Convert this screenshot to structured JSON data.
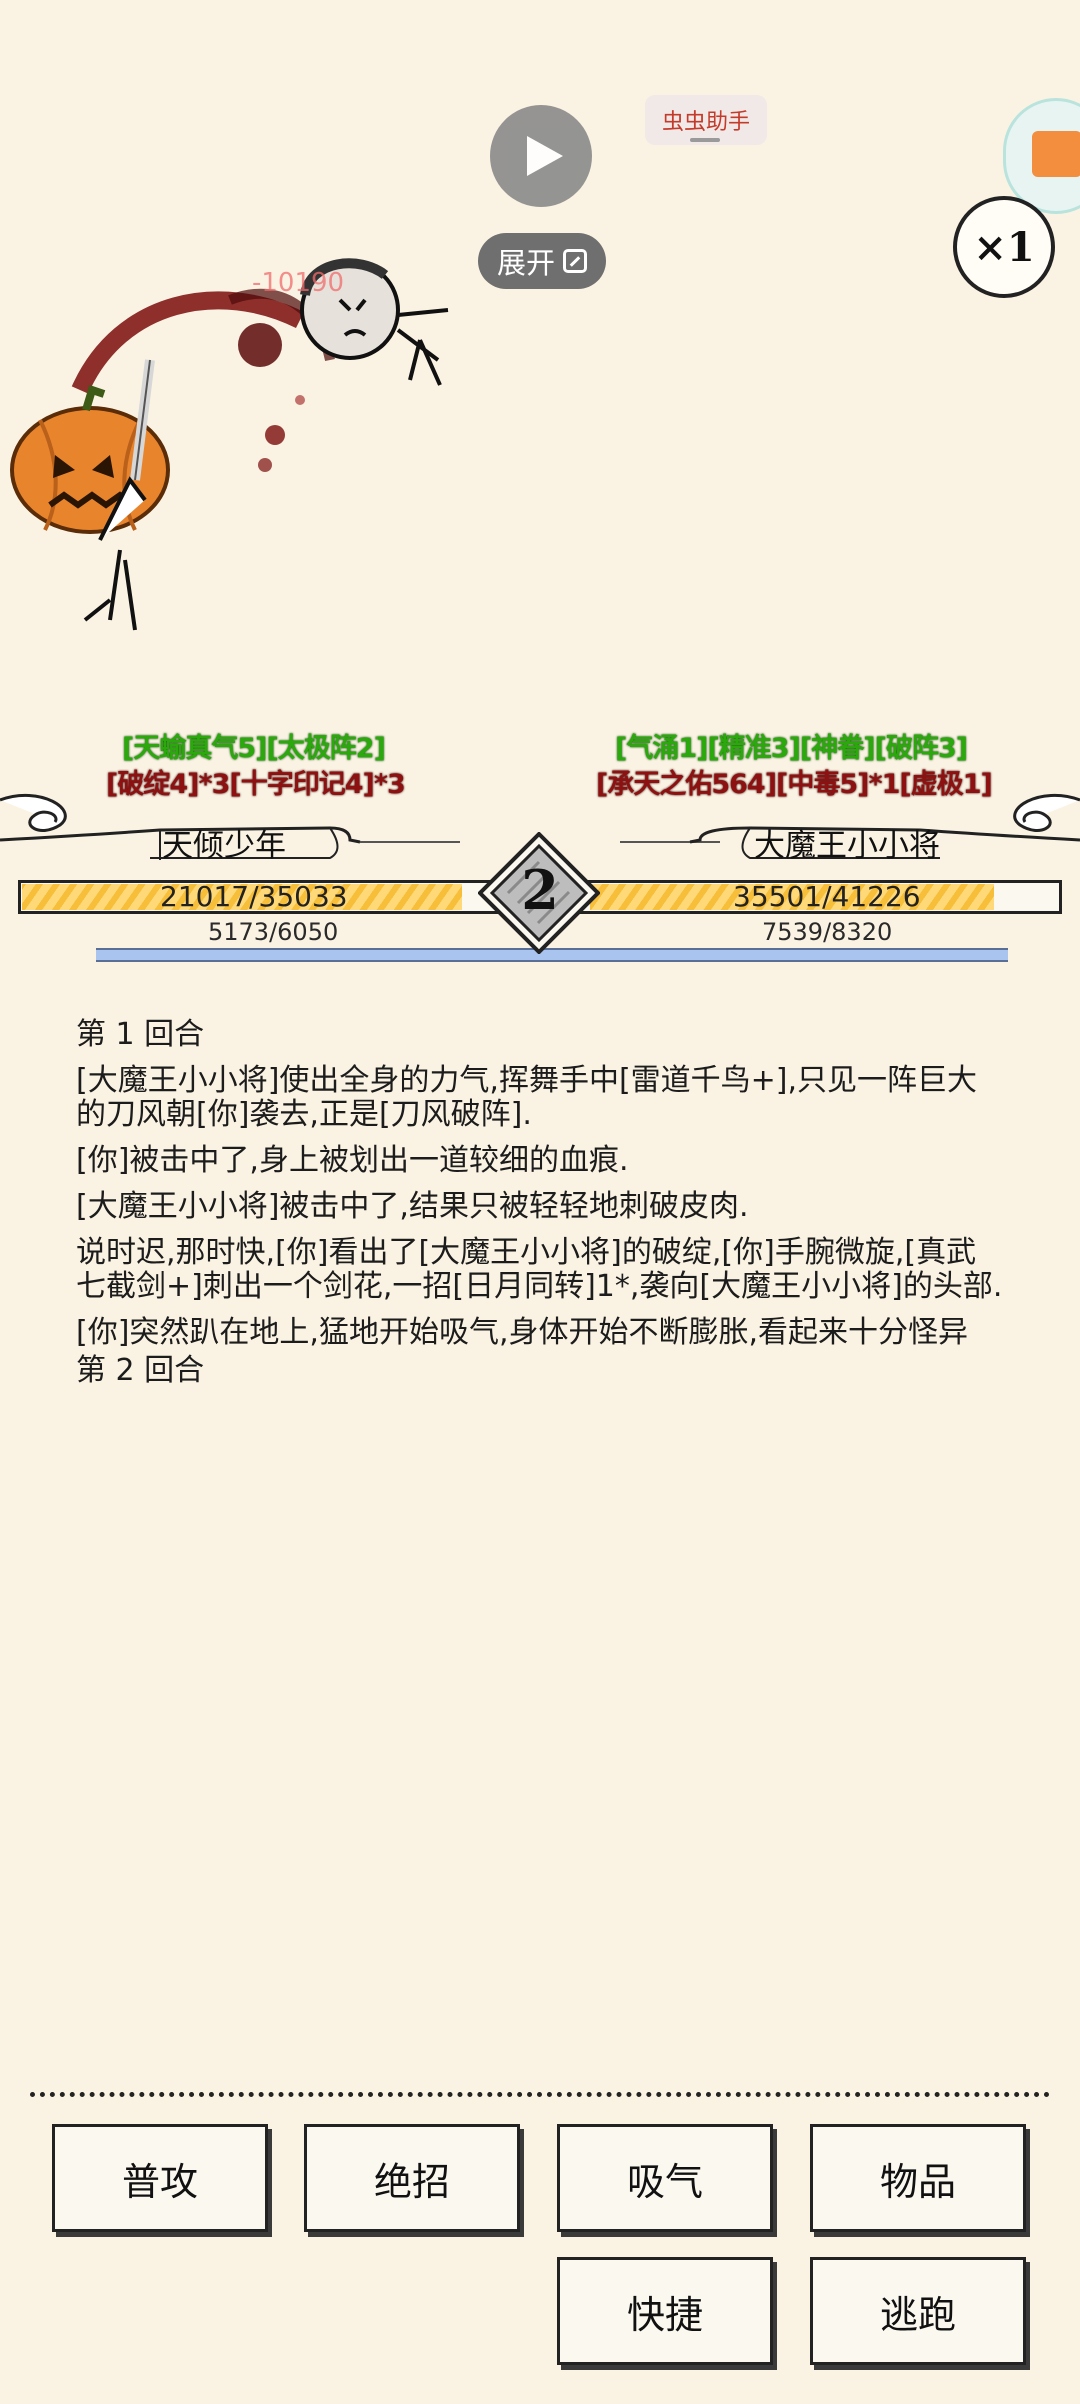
{
  "overlay": {
    "expand_label": "展开",
    "assistant_label": "虫虫助手",
    "speed_label": "×1"
  },
  "battle": {
    "damage_popup": "-10190",
    "round": "2",
    "player": {
      "name": "天倾少年",
      "buffs_positive": "[天蝓真气5][太极阵2]",
      "buffs_negative": "[破绽4]*3[十字印记4]*3",
      "hp": "21017/35033",
      "hp_fraction": 0.6,
      "mp": "5173/6050"
    },
    "enemy": {
      "name": "大魔王小小将",
      "buffs_positive": "[气涌1][精准3][神眷][破阵3]",
      "buffs_negative": "[承天之佑564][中毒5]*1[虚极1]",
      "hp": "35501/41226",
      "hp_fraction": 0.86,
      "mp": "7539/8320"
    }
  },
  "log": [
    "第 1 回合",
    "[大魔王小小将]使出全身的力气,挥舞手中[雷道千鸟+],只见一阵巨大的刀风朝[你]袭去,正是[刀风破阵].",
    "[你]被击中了,身上被划出一道较细的血痕.",
    "[大魔王小小将]被击中了,结果只被轻轻地刺破皮肉.",
    "说时迟,那时快,[你]看出了[大魔王小小将]的破绽,[你]手腕微旋,[真武七截剑+]刺出一个剑花,一招[日月同转]1*,袭向[大魔王小小将]的头部.",
    "[你]突然趴在地上,猛地开始吸气,身体开始不断膨胀,看起来十分怪异",
    "第 2 回合"
  ],
  "actions": {
    "attack": "普攻",
    "ultimate": "绝招",
    "breathe": "吸气",
    "items": "物品",
    "quick": "快捷",
    "flee": "逃跑"
  }
}
